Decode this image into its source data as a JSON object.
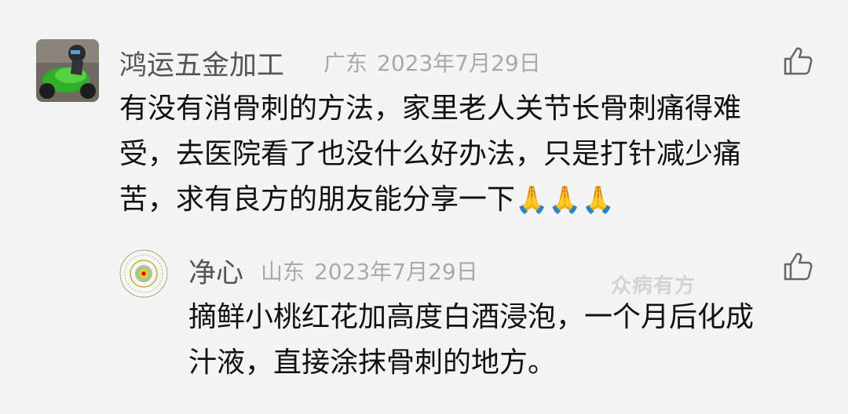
{
  "comment": {
    "author": "鸿运五金加工",
    "region": "广东",
    "date": "2023年7月29日",
    "lines": [
      "有没有消骨刺的方法，家里老人关节长骨刺痛得难",
      "受，去医院看了也没什么好办法，只是打针减少痛",
      "苦，求有良方的朋友能分享一下"
    ],
    "emoji": "🙏🙏🙏",
    "like_icon": "thumbs-up-icon"
  },
  "reply": {
    "author": "净心",
    "region": "山东",
    "date": "2023年7月29日",
    "lines": [
      "摘鲜小桃红花加高度白酒浸泡，一个月后化成",
      "汁液，直接涂抹骨刺的地方。"
    ],
    "like_icon": "thumbs-up-icon"
  },
  "watermark": "众病有方",
  "colors": {
    "name": "#555555",
    "meta": "#a9a9a9",
    "text": "#111111",
    "background": "#f4f4f4"
  }
}
